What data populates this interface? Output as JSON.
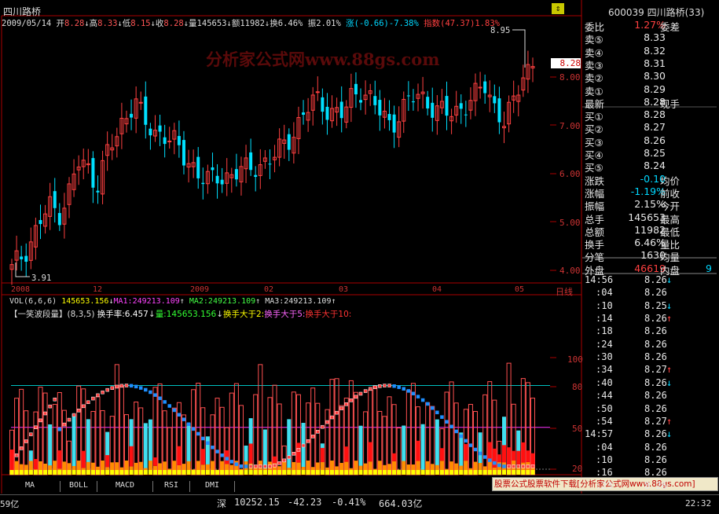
{
  "stock": {
    "name": "四川路桥",
    "code": "600039",
    "header": "600039 四川路桥(33)"
  },
  "infobar": {
    "date": "2009/05/14",
    "open_label": "开",
    "open": "8.28",
    "high_label": "高",
    "high": "8.33",
    "low_label": "低",
    "low": "8.15",
    "close_label": "收",
    "close": "8.28",
    "vol_label": "量",
    "vol": "145653",
    "amt_label": "额",
    "amt": "11982",
    "turn_label": "换",
    "turn": "6.46%",
    "amp_label": "振",
    "amp": "2.01%",
    "chg_label": "涨",
    "chg": "(-0.66)-7.38%",
    "index_label": "指数",
    "index": "(47.37)1.83%"
  },
  "watermark": "分析家公式网www.88gs.com",
  "price_axis": {
    "ticks": [
      "8.00",
      "7.00",
      "6.00",
      "5.00",
      "4.00"
    ],
    "current": "8.28",
    "max_label": "8.95",
    "min_label": "3.91"
  },
  "date_axis": {
    "labels": [
      "2008",
      "12",
      "2009",
      "02",
      "03",
      "04",
      "05"
    ],
    "period": "日线"
  },
  "vol_line": {
    "text": "VOL(6,6,6)",
    "vol": "145653.156",
    "ma1": "MA1:249213.109",
    "ma2": "MA2:249213.109",
    "ma3": "MA3:249213.109"
  },
  "indicator_line": {
    "title": "【一笑波段量】(8,3,5)",
    "turnover": "换手率:6.457",
    "vol": "量:145653.156",
    "t2": "换手大于2:",
    "t5": "换手大于5:",
    "t10": "换手大于10:"
  },
  "lower_axis": {
    "ticks": [
      "100",
      "80",
      "50",
      "20"
    ]
  },
  "bottom_tabs": [
    "MA",
    "BOLL",
    "MACD",
    "RSI",
    "DMI"
  ],
  "ad_text": "股票公式股票软件下载[分析家公式网www.88gs.com]",
  "status": {
    "left": "59亿",
    "index_name": "深",
    "index_val": "10252.15",
    "change": "-42.23",
    "pct": "-0.41%",
    "amount": "664.03亿",
    "time": "22:32"
  },
  "quote": {
    "webi_label": "委比",
    "webi_val": "1.27%",
    "weicha_label": "委差",
    "sells": [
      {
        "l": "卖⑤",
        "v": "8.33"
      },
      {
        "l": "卖④",
        "v": "8.32"
      },
      {
        "l": "卖③",
        "v": "8.31"
      },
      {
        "l": "卖②",
        "v": "8.30"
      },
      {
        "l": "卖①",
        "v": "8.29"
      }
    ],
    "last_label": "最新",
    "last_val": "8.28",
    "xianshou": "现手",
    "buys": [
      {
        "l": "买①",
        "v": "8.28"
      },
      {
        "l": "买②",
        "v": "8.27"
      },
      {
        "l": "买③",
        "v": "8.26"
      },
      {
        "l": "买④",
        "v": "8.25"
      },
      {
        "l": "买⑤",
        "v": "8.24"
      }
    ],
    "stats": [
      {
        "l": "涨跌",
        "v": "-0.10",
        "r": "均价"
      },
      {
        "l": "涨幅",
        "v": "-1.19%",
        "r": "前收"
      },
      {
        "l": "振幅",
        "v": "2.15%",
        "r": "今开"
      },
      {
        "l": "总手",
        "v": "145653",
        "r": "最高"
      },
      {
        "l": "总额",
        "v": "11982",
        "r": "最低"
      },
      {
        "l": "换手",
        "v": "6.46%",
        "r": "量比"
      },
      {
        "l": "分笔",
        "v": "1630",
        "r": "均量"
      }
    ],
    "waipan_label": "外盘",
    "waipan": "46619",
    "neipan_label": "内盘",
    "neipan_val": "9"
  },
  "ticks": [
    {
      "t": "14:56",
      "p": "8.26",
      "a": "↓"
    },
    {
      "t": ":04",
      "p": "8.26",
      "a": ""
    },
    {
      "t": ":10",
      "p": "8.25",
      "a": "↓"
    },
    {
      "t": ":14",
      "p": "8.26",
      "a": "↑"
    },
    {
      "t": ":18",
      "p": "8.26",
      "a": ""
    },
    {
      "t": ":24",
      "p": "8.26",
      "a": ""
    },
    {
      "t": ":30",
      "p": "8.26",
      "a": ""
    },
    {
      "t": ":34",
      "p": "8.27",
      "a": "↑"
    },
    {
      "t": ":40",
      "p": "8.26",
      "a": "↓"
    },
    {
      "t": ":44",
      "p": "8.26",
      "a": ""
    },
    {
      "t": ":50",
      "p": "8.26",
      "a": ""
    },
    {
      "t": ":54",
      "p": "8.27",
      "a": "↑"
    },
    {
      "t": "14:57",
      "p": "8.26",
      "a": "↓"
    },
    {
      "t": ":04",
      "p": "8.26",
      "a": ""
    },
    {
      "t": ":10",
      "p": "8.26",
      "a": ""
    },
    {
      "t": ":16",
      "p": "8.26",
      "a": ""
    },
    {
      "t": ":23",
      "p": "8.26",
      "a": ""
    }
  ],
  "chart_data": {
    "type": "candlestick",
    "price_ylim": [
      3.8,
      9.0
    ],
    "price_series_approx": [
      4.0,
      4.3,
      4.6,
      5.0,
      5.3,
      5.2,
      5.6,
      6.2,
      6.1,
      5.8,
      6.4,
      6.7,
      7.2,
      7.6,
      7.0,
      6.8,
      6.9,
      6.7,
      6.3,
      6.2,
      6.0,
      5.8,
      5.9,
      6.0,
      6.1,
      6.0,
      6.2,
      6.3,
      6.4,
      6.6,
      7.0,
      7.3,
      7.5,
      7.4,
      7.3,
      7.2,
      7.6,
      7.8,
      7.5,
      7.2,
      7.0,
      7.3,
      7.5,
      7.6,
      7.5,
      7.3,
      7.2,
      7.3,
      7.5,
      7.6,
      7.8,
      7.4,
      7.1,
      7.4,
      8.1,
      8.3
    ],
    "turnover_ylim": [
      20,
      100
    ],
    "turnover_lines": [
      80,
      50
    ]
  }
}
